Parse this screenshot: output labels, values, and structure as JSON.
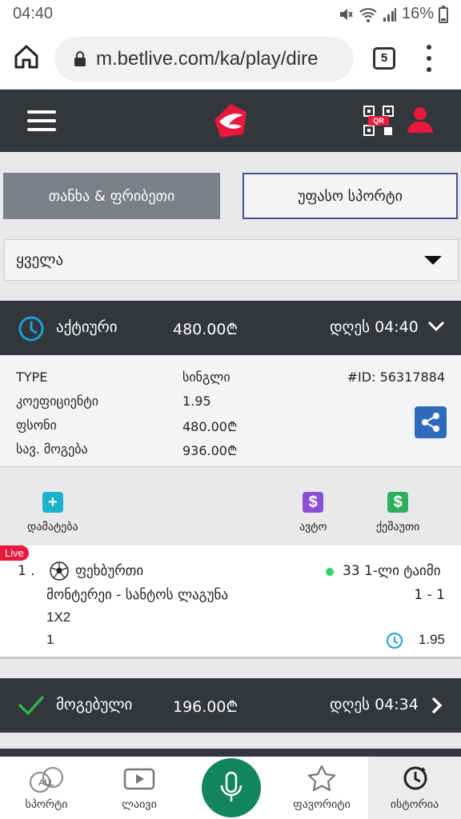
{
  "status_bar": {
    "time": "04:40",
    "battery": "16%"
  },
  "browser": {
    "url": "m.betlive.com/ka/play/dire",
    "tab_count": "5"
  },
  "toggle": {
    "left_label": "თანხა & ფრიბეთი",
    "right_label": "უფასო სპორტი"
  },
  "filter": {
    "selected": "ყველა"
  },
  "active_bet": {
    "status": "აქტიური",
    "amount": "480.00₾",
    "time": "დღეს 04:40",
    "type_label": "TYPE",
    "type_value": "სინგლი",
    "id": "#ID: 56317884",
    "odds_label": "კოეფიციენტი",
    "odds_value": "1.95",
    "stake_label": "ფსონი",
    "stake_value": "480.00₾",
    "payout_label": "სავ. მოგება",
    "payout_value": "936.00₾"
  },
  "actions": {
    "add": "დამატება",
    "auto": "ავტო",
    "cashout": "ქეშაუთი",
    "add_glyph": "+",
    "auto_glyph": "$",
    "cashout_glyph": "$"
  },
  "selection": {
    "live_badge": "Live",
    "index": "1 .",
    "sport": "ფეხბურთი",
    "match_time": "33 1-ლი ტაიმი",
    "teams": "მონტერეი - სანტოს ლაგუნა",
    "score": "1 - 1",
    "market": "1X2",
    "pick": "1",
    "odds": "1.95"
  },
  "won_bet": {
    "status": "მოგებული",
    "amount": "196.00₾",
    "time": "დღეს 04:34"
  },
  "bottom_nav": {
    "sport": "სპორტი",
    "sport_badge": "ALL",
    "live": "ლაივი",
    "favorites": "ფავორიტი",
    "history": "ისტორია"
  },
  "colors": {
    "header_dark": "#33363b",
    "accent_red": "#e8193c",
    "active_blue": "#1aa0d8",
    "win_green": "#2fb54a",
    "share_blue": "#2f6bbd",
    "add_teal": "#1bb3c9",
    "auto_purple": "#8a4fd6",
    "cashout_green": "#2fae5e",
    "mic_green": "#13855e"
  }
}
